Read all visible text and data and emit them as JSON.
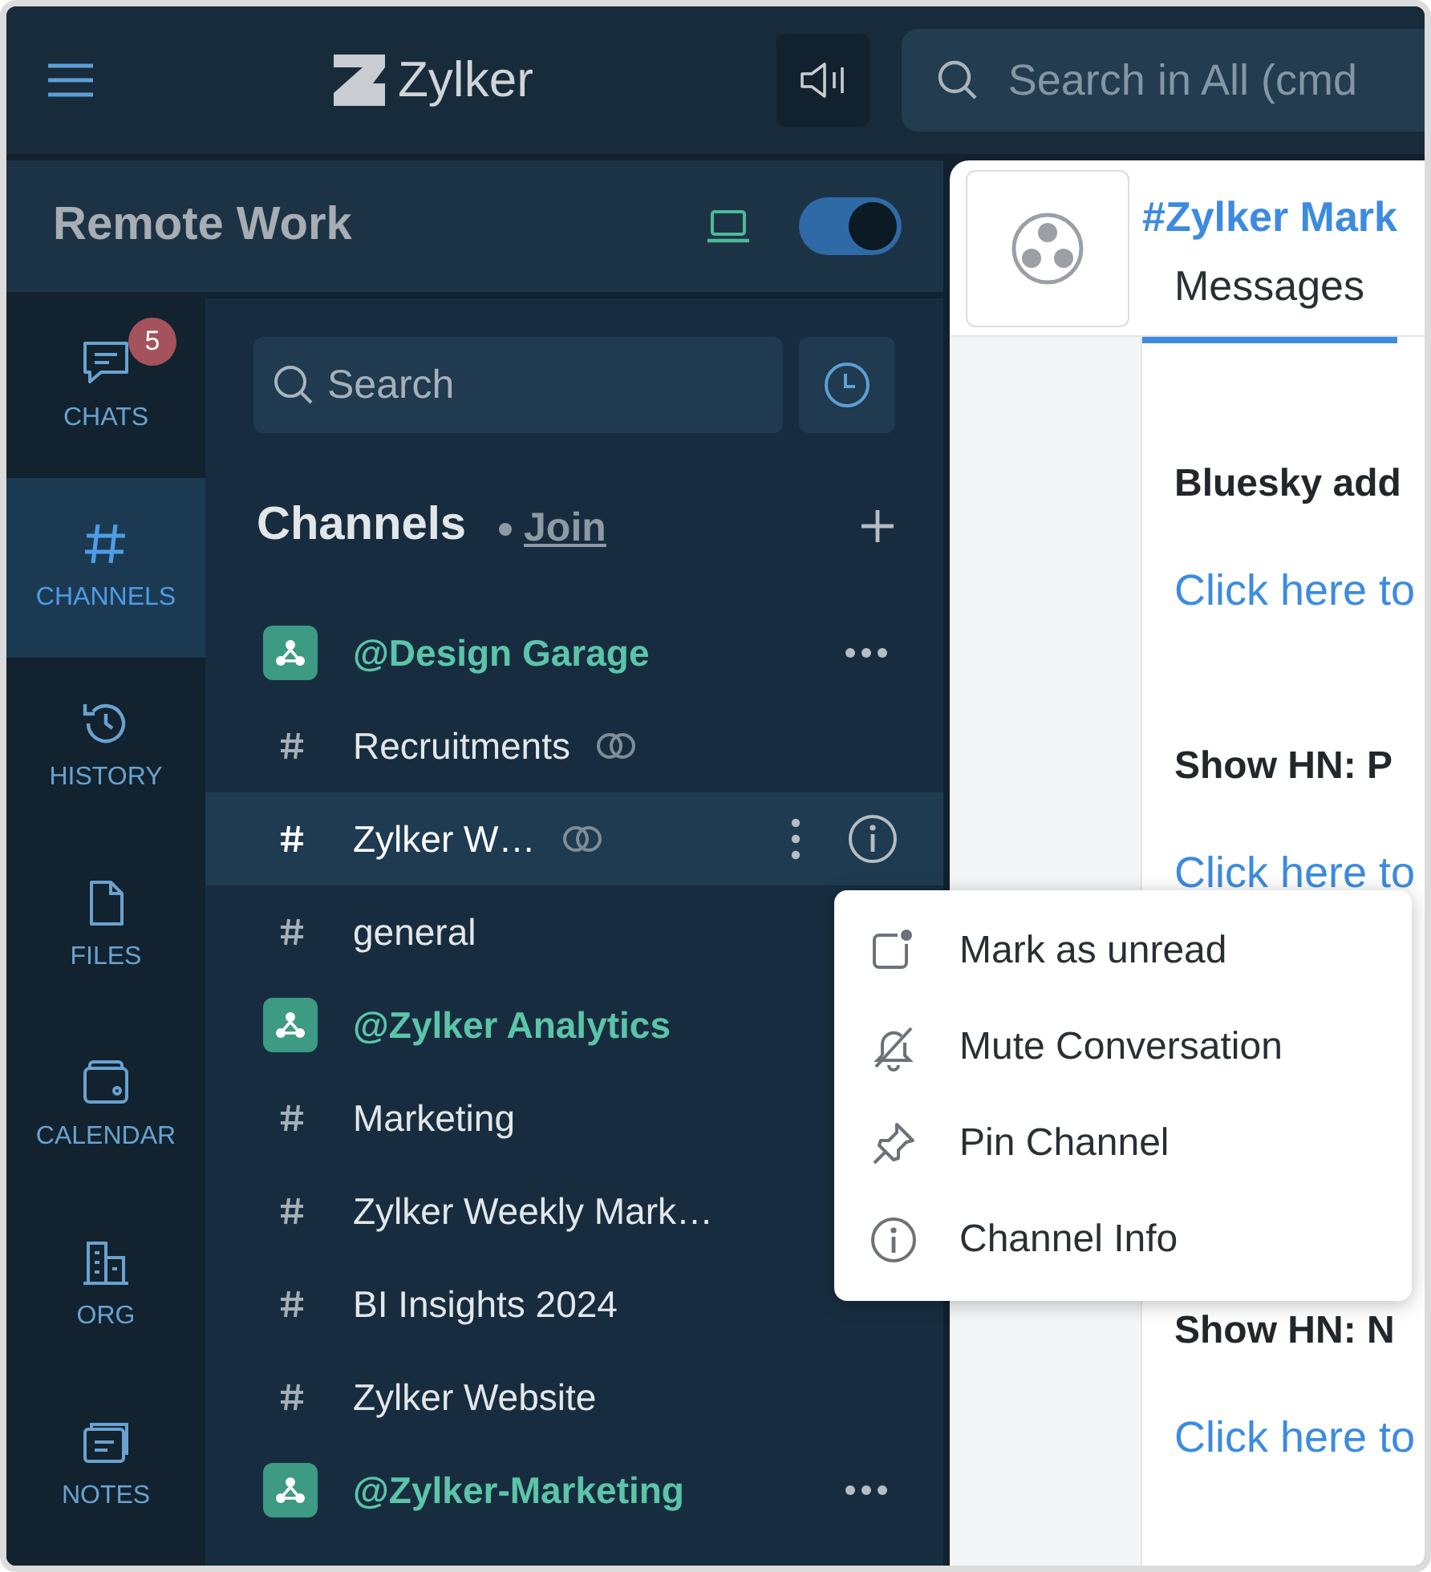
{
  "topbar": {
    "brand": "Zylker",
    "search": {
      "placeholder": "Search in All (cmd"
    }
  },
  "workspace": {
    "name": "Remote Work",
    "toggle_on": true
  },
  "rail": [
    {
      "kind": "chat",
      "label": "CHATS",
      "badge": "5",
      "selected": false
    },
    {
      "kind": "hash",
      "label": "CHANNELS",
      "selected": true
    },
    {
      "kind": "history",
      "label": "HISTORY",
      "selected": false
    },
    {
      "kind": "file",
      "label": "FILES",
      "selected": false
    },
    {
      "kind": "calendar",
      "label": "CALENDAR",
      "selected": false
    },
    {
      "kind": "org",
      "label": "ORG",
      "selected": false
    },
    {
      "kind": "notes",
      "label": "NOTES",
      "selected": false
    }
  ],
  "channel_panel": {
    "search": {
      "placeholder": "Search"
    },
    "title": "Channels",
    "join": "Join",
    "groups": [
      {
        "name": "@Design Garage",
        "menu_button": true,
        "channels": [
          {
            "name": "Recruitments",
            "linked": true,
            "selected": false
          },
          {
            "name": "Zylker W…",
            "linked": true,
            "selected": true
          },
          {
            "name": "general",
            "linked": false,
            "selected": false
          }
        ]
      },
      {
        "name": "@Zylker Analytics",
        "menu_button": false,
        "channels": [
          {
            "name": "Marketing",
            "linked": false,
            "selected": false
          },
          {
            "name": "Zylker Weekly Mark…",
            "linked": false,
            "selected": false
          },
          {
            "name": "BI Insights 2024",
            "linked": false,
            "selected": false
          },
          {
            "name": "Zylker Website",
            "linked": false,
            "selected": false
          }
        ]
      },
      {
        "name": "@Zylker-Marketing",
        "menu_button": true
      }
    ]
  },
  "conversation": {
    "title": "#Zylker Mark",
    "tabs": [
      {
        "label": "Messages",
        "selected": true
      }
    ],
    "messages": [
      {
        "kind": "post",
        "title": "Bluesky add",
        "link": "Click here to"
      },
      {
        "kind": "post",
        "title": "Show HN: P",
        "link": "Click here to"
      },
      {
        "kind": "covered"
      },
      {
        "kind": "post",
        "title": "Show HN: N",
        "link": "Click here to"
      }
    ]
  },
  "context_menu": [
    {
      "kind": "unread",
      "label": "Mark as unread"
    },
    {
      "kind": "mute",
      "label": "Mute Conversation"
    },
    {
      "kind": "pin",
      "label": "Pin Channel"
    },
    {
      "kind": "info",
      "label": "Channel Info"
    }
  ]
}
